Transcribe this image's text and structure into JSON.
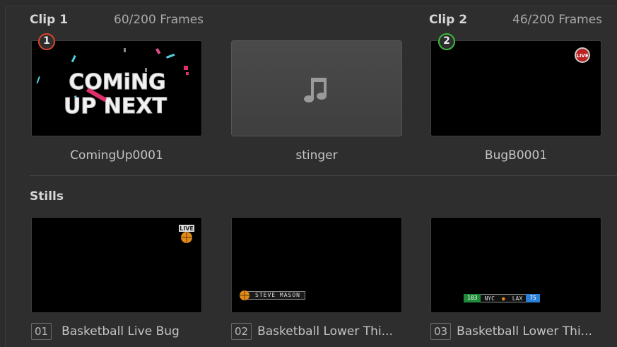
{
  "clip1": {
    "label": "Clip 1",
    "frames": "60/200 Frames",
    "badge": "1"
  },
  "clip2": {
    "label": "Clip 2",
    "frames": "46/200 Frames",
    "badge": "2"
  },
  "clips": [
    {
      "name": "ComingUp0001",
      "art_line1": "COMiNG",
      "art_line2": "UP NEXT"
    },
    {
      "name": "stinger",
      "icon": "music-note-icon"
    },
    {
      "name": "BugB0001",
      "bug_text": "LIVE"
    }
  ],
  "stills_title": "Stills",
  "stills": [
    {
      "index": "01",
      "name": "Basketball Live Bug",
      "bug_text": "LIVE"
    },
    {
      "index": "02",
      "name": "Basketball Lower Thi...",
      "lower_third": "STEVE MASON"
    },
    {
      "index": "03",
      "name": "Basketball Lower Thi...",
      "score_home": "103",
      "team_home": "NYC",
      "team_away": "LAX",
      "score_away": "75"
    }
  ],
  "colors": {
    "badge1": "#e0432b",
    "badge2": "#3bbd3b",
    "background": "#2e2e2e"
  }
}
